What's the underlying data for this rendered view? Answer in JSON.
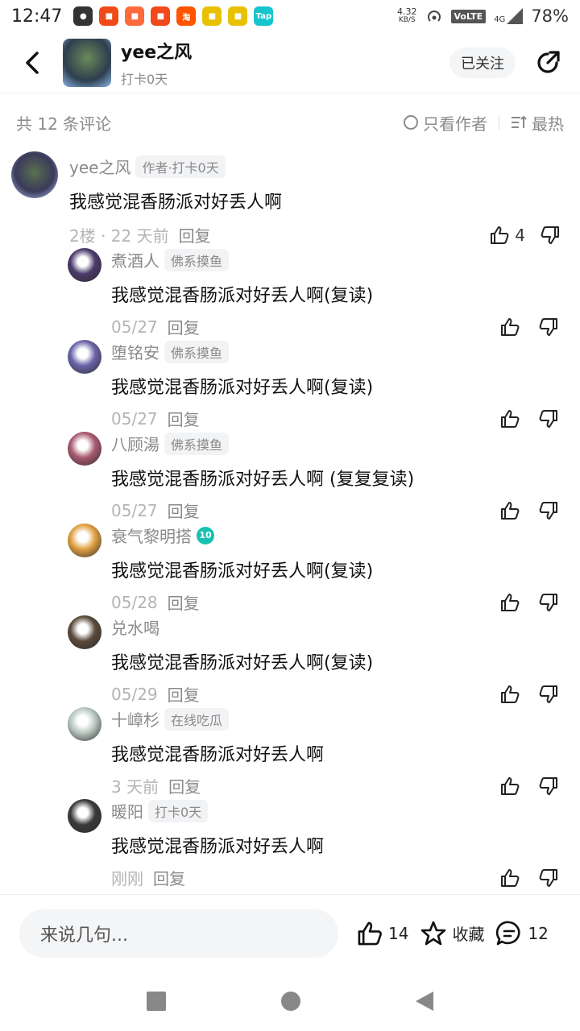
{
  "status_bar": {
    "time": "12:47",
    "speed_value": "4.32",
    "speed_unit": "KB/S",
    "volte": "VoLTE",
    "network": "4G",
    "battery": "78%",
    "app_icons": [
      {
        "name": "message-app-icon",
        "color": "#333333",
        "glyph": "●"
      },
      {
        "name": "taobao-special-icon",
        "color": "#f04a1a",
        "glyph": "■"
      },
      {
        "name": "shopping-app-icon",
        "color": "#ff6a3d",
        "glyph": "■"
      },
      {
        "name": "taobao-special-icon-2",
        "color": "#f04a1a",
        "glyph": "■"
      },
      {
        "name": "taobao-icon",
        "color": "#ff5500",
        "glyph": "淘"
      },
      {
        "name": "today-headline-icon",
        "color": "#e8c200",
        "glyph": "■"
      },
      {
        "name": "today-headline-icon-2",
        "color": "#e8c200",
        "glyph": "■"
      },
      {
        "name": "taptap-icon",
        "color": "#15c5ce",
        "glyph": "Tap"
      }
    ]
  },
  "header": {
    "name": "yee之风",
    "sub": "打卡0天",
    "follow_label": "已关注"
  },
  "toolbar": {
    "count": "共 12 条评论",
    "author_only": "只看作者",
    "sort_label": "最热"
  },
  "main_comment": {
    "username": "yee之风",
    "tag": "作者·打卡0天",
    "text": "我感觉混香肠派对好丢人啊",
    "meta": "2楼 · 22 天前",
    "reply_label": "回复",
    "likes": "4"
  },
  "replies": [
    {
      "username": "煮酒人",
      "tag": "佛系摸鱼",
      "text": "我感觉混香肠派对好丢人啊(复读)",
      "date": "05/27",
      "reply_label": "回复",
      "avatar_color": "#4a3a6a"
    },
    {
      "username": "堕铭安",
      "tag": "佛系摸鱼",
      "text": "我感觉混香肠派对好丢人啊(复读)",
      "date": "05/27",
      "reply_label": "回复",
      "avatar_color": "#6a64a8"
    },
    {
      "username": "八顾湯",
      "tag": "佛系摸鱼",
      "text": "我感觉混香肠派对好丢人啊 (复复复读)",
      "date": "05/27",
      "reply_label": "回复",
      "avatar_color": "#a85a70"
    },
    {
      "username": "衰气黎明搭",
      "tag": "",
      "level": "10",
      "text": "我感觉混香肠派对好丢人啊(复读)",
      "date": "05/28",
      "reply_label": "回复",
      "avatar_color": "#e0a040"
    },
    {
      "username": "兑水喝",
      "tag": "",
      "text": "我感觉混香肠派对好丢人啊(复读)",
      "date": "05/29",
      "reply_label": "回复",
      "avatar_color": "#5a4a3a"
    },
    {
      "username": "十嶂杉",
      "tag": "在线吃瓜",
      "text": "我感觉混香肠派对好丢人啊",
      "date": "3 天前",
      "reply_label": "回复",
      "avatar_color": "#b8c8c0"
    },
    {
      "username": "暖阳",
      "tag": "打卡0天",
      "text": "我感觉混香肠派对好丢人啊",
      "date": "刚刚",
      "reply_label": "回复",
      "avatar_color": "#3a3a3a"
    }
  ],
  "bottom_bar": {
    "input_placeholder": "来说几句...",
    "likes": "14",
    "favorite_label": "收藏",
    "comments": "12"
  }
}
